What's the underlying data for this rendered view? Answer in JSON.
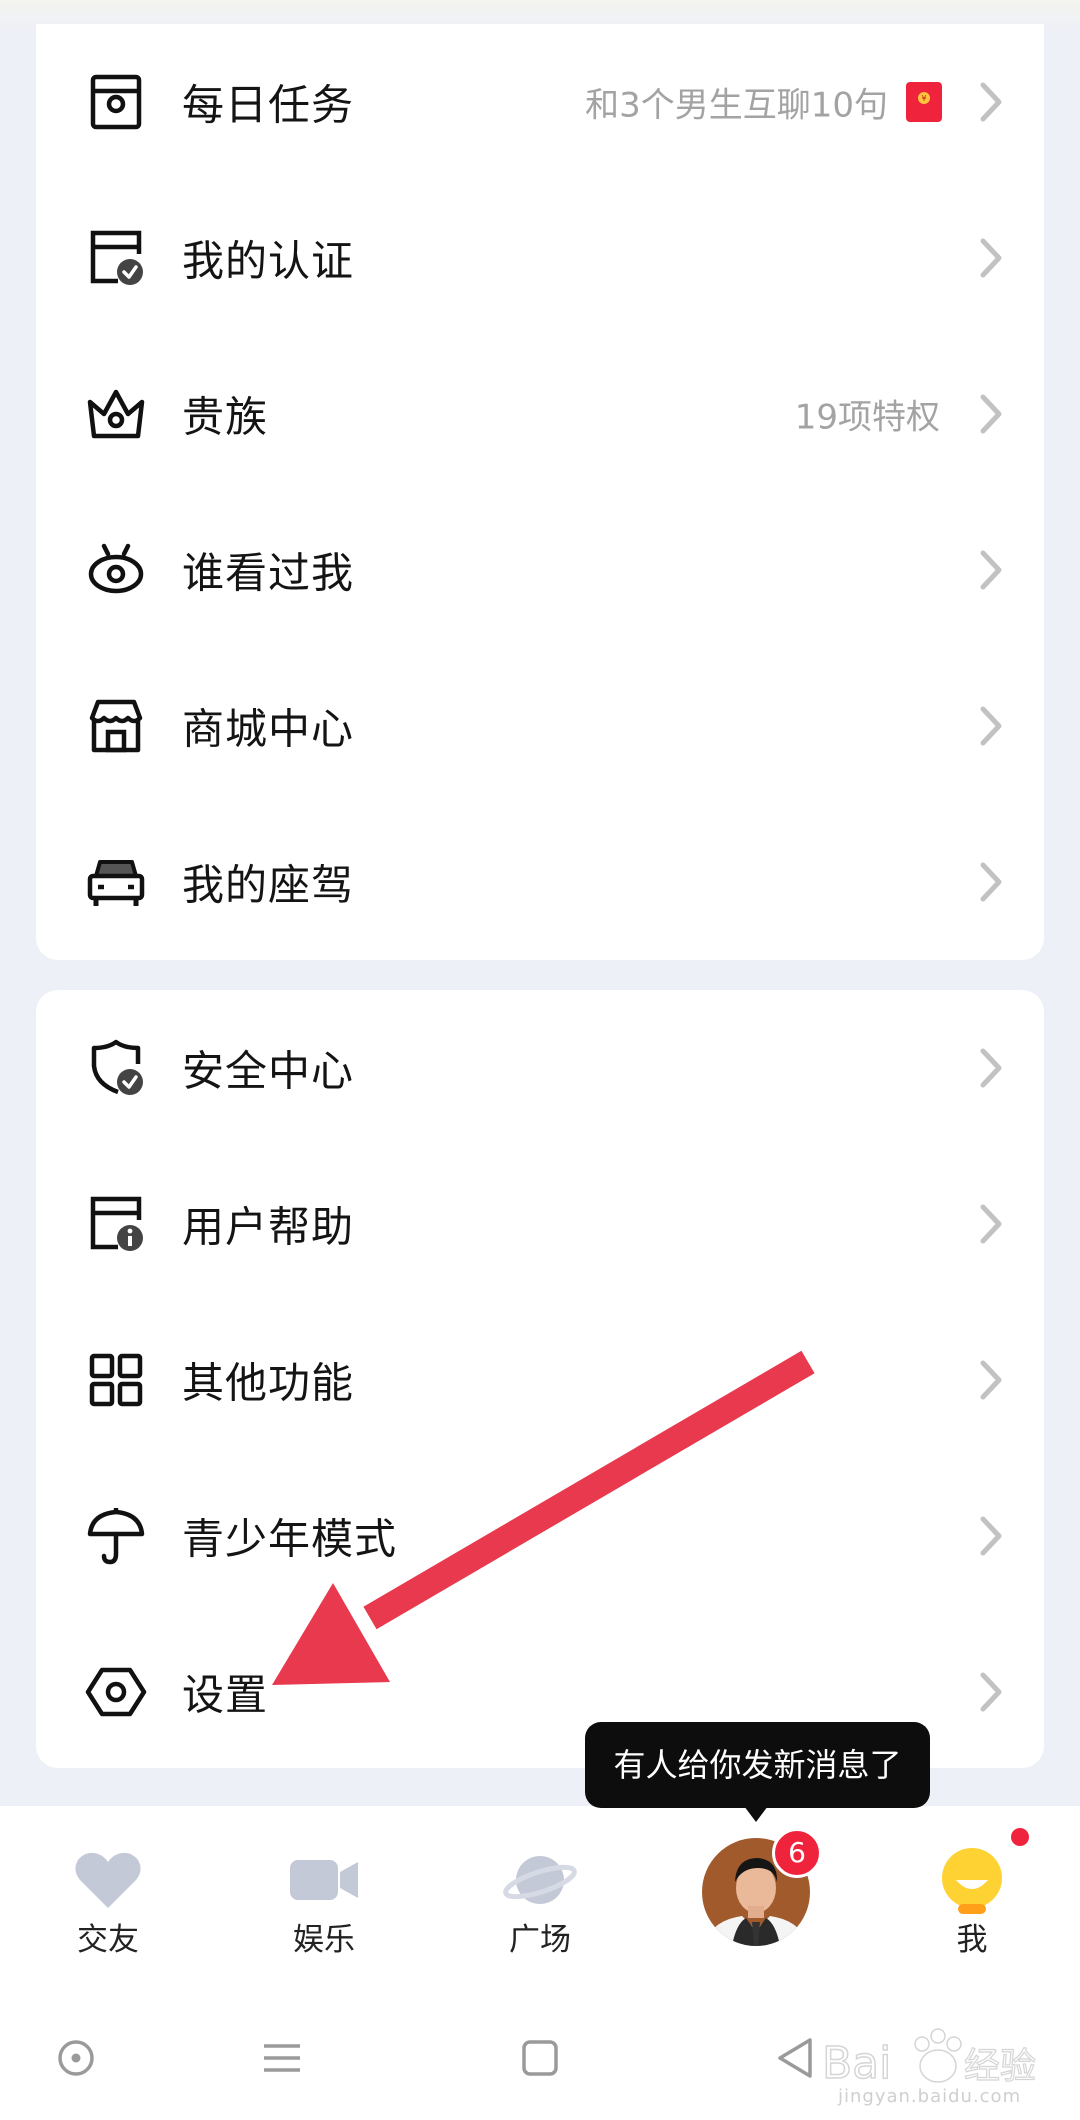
{
  "menu_card_1": [
    {
      "id": "daily",
      "label": "每日任务",
      "extra": "和3个男生互聊10句",
      "icon": "task-icon",
      "has_packet": true
    },
    {
      "id": "verify",
      "label": "我的认证",
      "extra": "",
      "icon": "certificate-icon"
    },
    {
      "id": "noble",
      "label": "贵族",
      "extra": "19项特权",
      "icon": "crown-icon"
    },
    {
      "id": "visitors",
      "label": "谁看过我",
      "extra": "",
      "icon": "eye-icon"
    },
    {
      "id": "mall",
      "label": "商城中心",
      "extra": "",
      "icon": "store-icon"
    },
    {
      "id": "car",
      "label": "我的座驾",
      "extra": "",
      "icon": "car-icon"
    }
  ],
  "menu_card_2": [
    {
      "id": "security",
      "label": "安全中心",
      "icon": "shield-icon"
    },
    {
      "id": "help",
      "label": "用户帮助",
      "icon": "info-doc-icon"
    },
    {
      "id": "other",
      "label": "其他功能",
      "icon": "grid-icon"
    },
    {
      "id": "teen",
      "label": "青少年模式",
      "icon": "umbrella-icon"
    },
    {
      "id": "settings",
      "label": "设置",
      "icon": "hexagon-settings-icon"
    }
  ],
  "tooltip": "有人给你发新消息了",
  "tabs": [
    {
      "label": "交友",
      "icon": "heart-icon"
    },
    {
      "label": "娱乐",
      "icon": "video-camera-icon"
    },
    {
      "label": "广场",
      "icon": "planet-icon"
    },
    {
      "label": "",
      "icon": "avatar",
      "badge": "6"
    },
    {
      "label": "我",
      "icon": "smiley-face-icon",
      "has_dot": true
    }
  ],
  "watermark": {
    "text": "jingyan.baidu.com",
    "logo_text": "Bai经验"
  },
  "colors": {
    "accent_red": "#f0233d",
    "arrow": "#e8394e",
    "tab_icon_gray": "#c4c9d8",
    "me_yellow": "#ffd233",
    "me_orange": "#ff9f1a"
  }
}
